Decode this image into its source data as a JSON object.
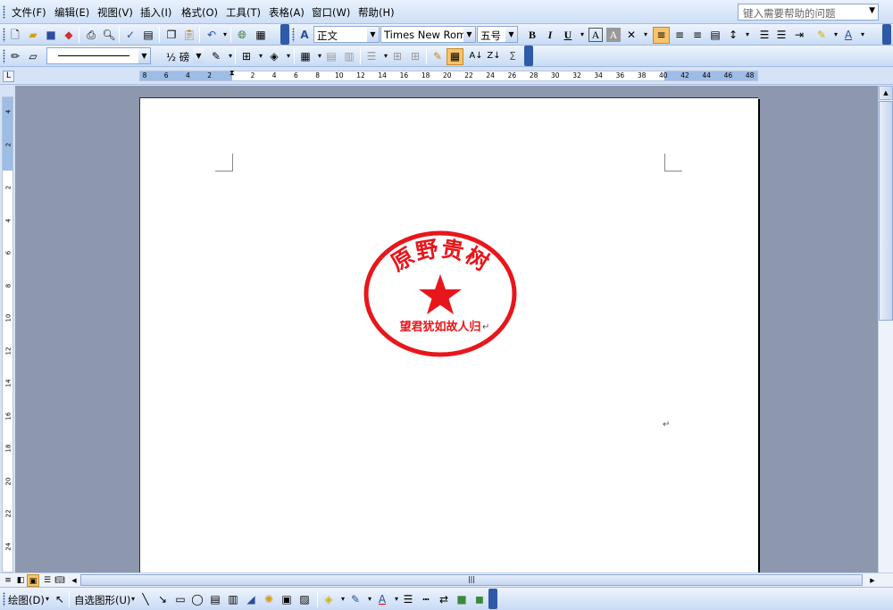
{
  "menu": {
    "items": [
      "文件(F)",
      "编辑(E)",
      "视图(V)",
      "插入(I)",
      "格式(O)",
      "工具(T)",
      "表格(A)",
      "窗口(W)",
      "帮助(H)"
    ],
    "help_placeholder": "键入需要帮助的问题"
  },
  "format_toolbar": {
    "style": "正文",
    "font": "Times New Roman",
    "size": "五号",
    "bold": "B",
    "italic": "I",
    "underline": "U"
  },
  "tables_toolbar": {
    "line_weight": "½ 磅"
  },
  "ruler": {
    "h_ticks": [
      "8",
      "6",
      "4",
      "2",
      "2",
      "4",
      "6",
      "8",
      "10",
      "12",
      "14",
      "16",
      "18",
      "20",
      "22",
      "24",
      "26",
      "28",
      "30",
      "32",
      "34",
      "36",
      "38",
      "40",
      "42",
      "44",
      "46",
      "48"
    ],
    "v_ticks": [
      "4",
      "2",
      "2",
      "4",
      "6",
      "8",
      "10",
      "12",
      "14",
      "16",
      "18",
      "20",
      "22",
      "24"
    ]
  },
  "document": {
    "seal": {
      "arc_text": "原野贵树",
      "bottom_text": "望君犹如故人归",
      "color": "#e8161b"
    }
  },
  "drawing_toolbar": {
    "draw_label": "绘图(D)",
    "autoshapes_label": "自选图形(U)"
  },
  "colors": {
    "seal_red": "#e8161b",
    "workspace": "#8d97ae",
    "toolbar_blue": "#c8dbf5"
  }
}
